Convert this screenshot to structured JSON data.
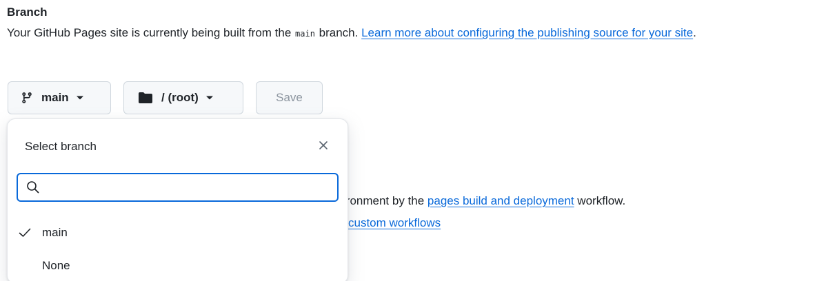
{
  "section": {
    "title": "Branch",
    "desc_prefix": "Your GitHub Pages site is currently being built from the ",
    "desc_code": "main",
    "desc_suffix": " branch. ",
    "desc_link": "Learn more about configuring the publishing source for your site",
    "desc_end": "."
  },
  "controls": {
    "branch_label": "main",
    "folder_label": "/ (root)",
    "save_label": "Save"
  },
  "background": {
    "line1_prefix": "ironment by the ",
    "line1_link": "pages build and deployment",
    "line1_suffix": " workflow.",
    "line2_link": "custom workflows"
  },
  "dropdown": {
    "title": "Select branch",
    "search_placeholder": "",
    "items": [
      {
        "label": "main",
        "selected": true
      },
      {
        "label": "None",
        "selected": false
      }
    ]
  },
  "icons": {
    "branch": "git-branch-icon",
    "folder": "folder-icon",
    "caret": "triangle-down-icon",
    "close": "x-icon",
    "search": "search-icon",
    "check": "check-icon"
  },
  "colors": {
    "link": "#0969da",
    "focus_border": "#0969da",
    "disabled_text": "#8c959f",
    "button_bg": "#f6f8fa"
  }
}
